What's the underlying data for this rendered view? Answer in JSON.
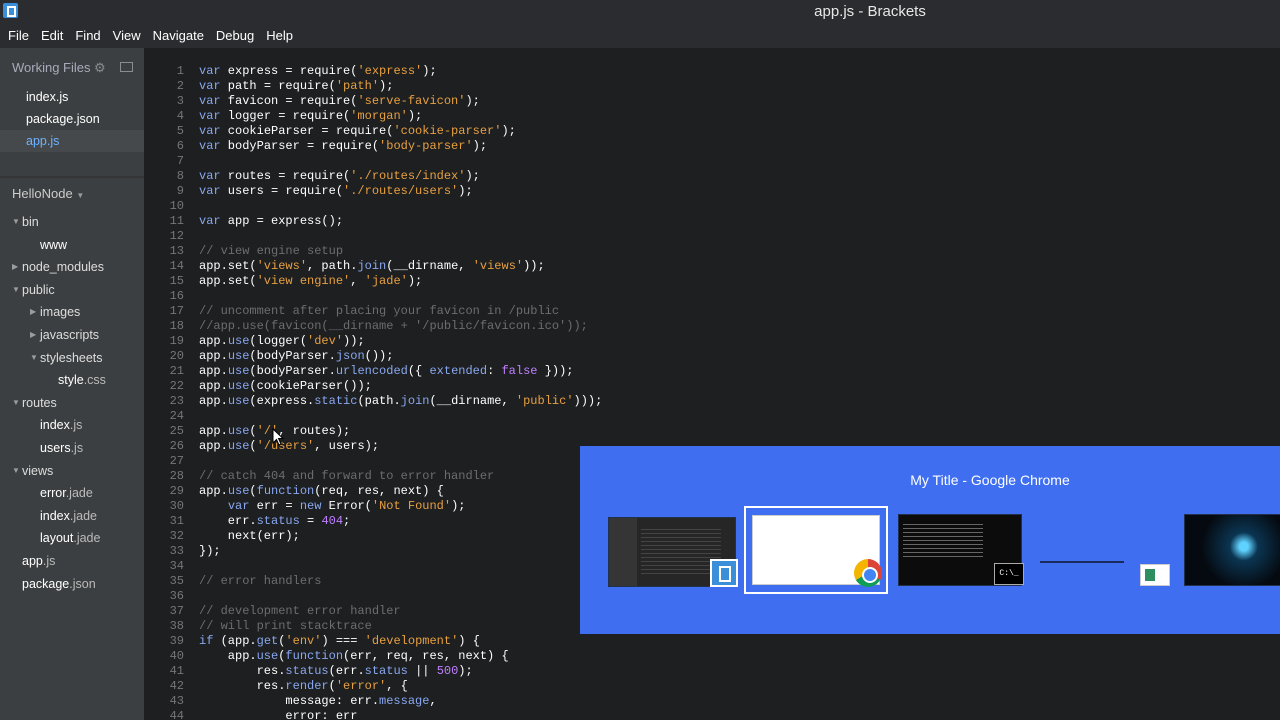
{
  "window": {
    "title": "app.js - Brackets"
  },
  "menu": [
    "File",
    "Edit",
    "Find",
    "View",
    "Navigate",
    "Debug",
    "Help"
  ],
  "working_files": {
    "header": "Working Files",
    "items": [
      {
        "name": "index",
        "ext": ".js"
      },
      {
        "name": "package",
        "ext": ".json"
      },
      {
        "name": "app",
        "ext": ".js"
      }
    ]
  },
  "project": {
    "name": "HelloNode",
    "tree": [
      {
        "label": "bin",
        "type": "folder",
        "open": true,
        "depth": 0
      },
      {
        "label": "www",
        "type": "file",
        "depth": 1
      },
      {
        "label": "node_modules",
        "type": "folder",
        "open": false,
        "depth": 0
      },
      {
        "label": "public",
        "type": "folder",
        "open": true,
        "depth": 0
      },
      {
        "label": "images",
        "type": "folder",
        "open": false,
        "depth": 1
      },
      {
        "label": "javascripts",
        "type": "folder",
        "open": false,
        "depth": 1
      },
      {
        "label": "stylesheets",
        "type": "folder",
        "open": true,
        "depth": 1
      },
      {
        "label": "style",
        "ext": ".css",
        "type": "file",
        "depth": 2
      },
      {
        "label": "routes",
        "type": "folder",
        "open": true,
        "depth": 0
      },
      {
        "label": "index",
        "ext": ".js",
        "type": "file",
        "depth": 1
      },
      {
        "label": "users",
        "ext": ".js",
        "type": "file",
        "depth": 1
      },
      {
        "label": "views",
        "type": "folder",
        "open": true,
        "depth": 0
      },
      {
        "label": "error",
        "ext": ".jade",
        "type": "file",
        "depth": 1
      },
      {
        "label": "index",
        "ext": ".jade",
        "type": "file",
        "depth": 1
      },
      {
        "label": "layout",
        "ext": ".jade",
        "type": "file",
        "depth": 1
      },
      {
        "label": "app",
        "ext": ".js",
        "type": "file",
        "depth": 0
      },
      {
        "label": "package",
        "ext": ".json",
        "type": "file",
        "depth": 0
      }
    ]
  },
  "code": [
    "var express = require('express');",
    "var path = require('path');",
    "var favicon = require('serve-favicon');",
    "var logger = require('morgan');",
    "var cookieParser = require('cookie-parser');",
    "var bodyParser = require('body-parser');",
    "",
    "var routes = require('./routes/index');",
    "var users = require('./routes/users');",
    "",
    "var app = express();",
    "",
    "// view engine setup",
    "app.set('views', path.join(__dirname, 'views'));",
    "app.set('view engine', 'jade');",
    "",
    "// uncomment after placing your favicon in /public",
    "//app.use(favicon(__dirname + '/public/favicon.ico'));",
    "app.use(logger('dev'));",
    "app.use(bodyParser.json());",
    "app.use(bodyParser.urlencoded({ extended: false }));",
    "app.use(cookieParser());",
    "app.use(express.static(path.join(__dirname, 'public')));",
    "",
    "app.use('/', routes);",
    "app.use('/users', users);",
    "",
    "// catch 404 and forward to error handler",
    "app.use(function(req, res, next) {",
    "    var err = new Error('Not Found');",
    "    err.status = 404;",
    "    next(err);",
    "});",
    "",
    "// error handlers",
    "",
    "// development error handler",
    "// will print stacktrace",
    "if (app.get('env') === 'development') {",
    "    app.use(function(err, req, res, next) {",
    "        res.status(err.status || 500);",
    "        res.render('error', {",
    "            message: err.message,",
    "            error: err"
  ],
  "task_switcher": {
    "title": "My Title - Google Chrome",
    "cmd_label": "C:\\_"
  }
}
